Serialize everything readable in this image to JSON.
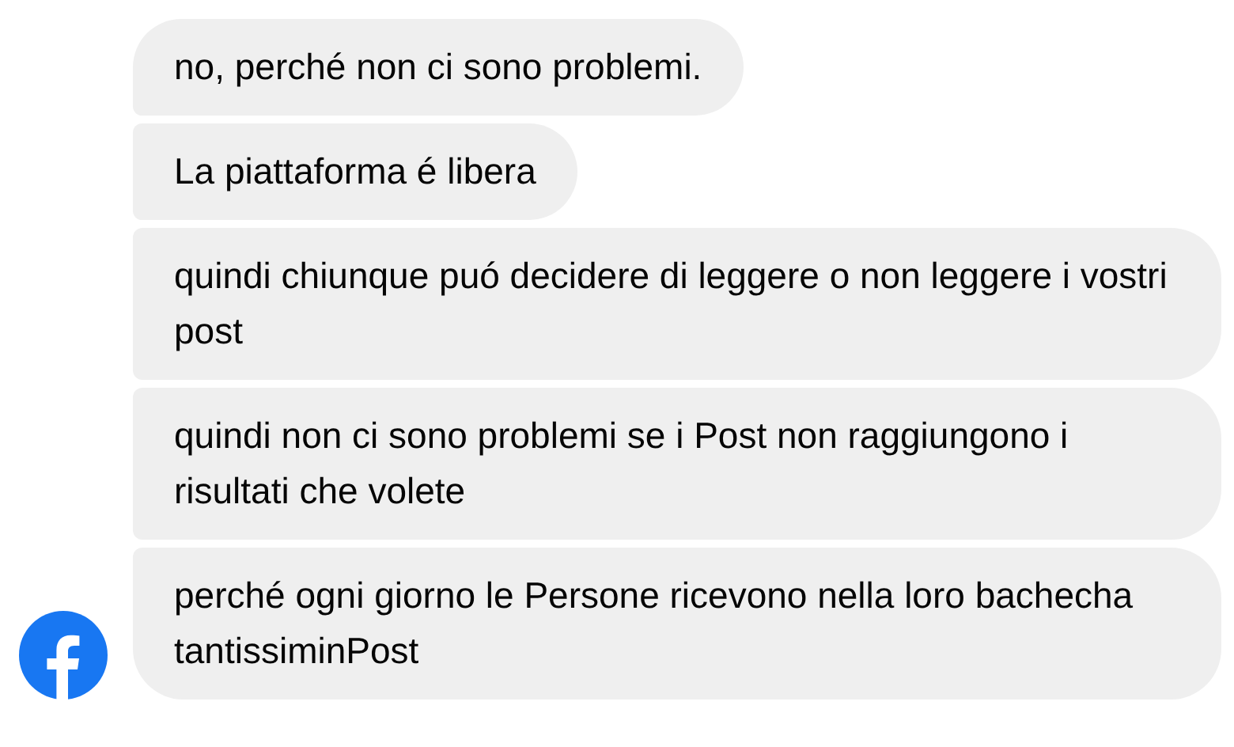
{
  "messages": [
    {
      "text": "no, perché non ci sono problemi."
    },
    {
      "text": "La piattaforma é libera"
    },
    {
      "text": "quindi chiunque puó decidere di leggere o non leggere i vostri post"
    },
    {
      "text": "quindi non ci sono problemi se i Post non raggiungono i risultati che volete"
    },
    {
      "text": "perché ogni giorno le Persone ricevono nella loro bachecha tantissiminPost"
    }
  ]
}
